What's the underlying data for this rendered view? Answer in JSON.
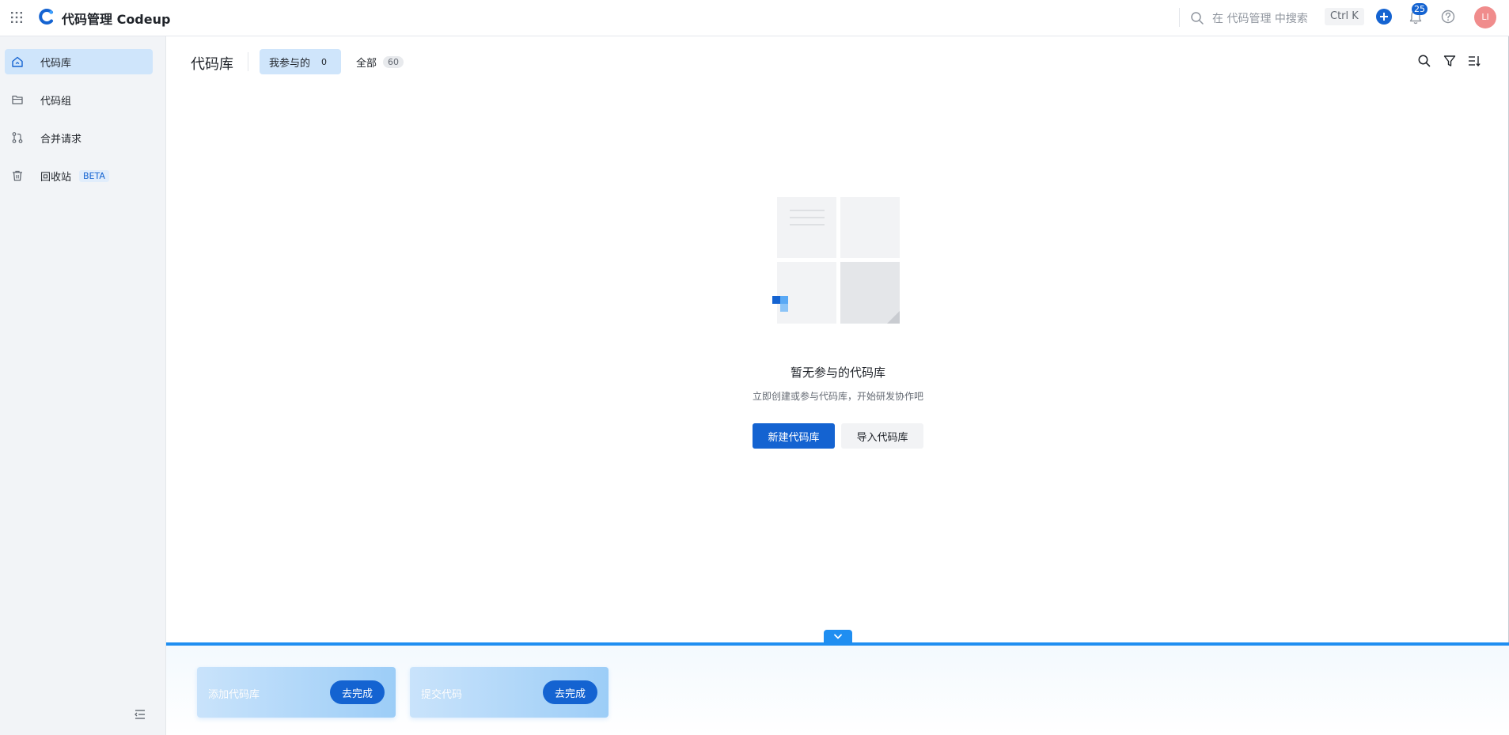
{
  "app": {
    "brand": "代码管理 Codeup",
    "search_placeholder": "在 代码管理 中搜索",
    "search_shortcut": "Ctrl K",
    "notification_count": "25",
    "avatar_initials": "LI",
    "accent_color": "#1463d1"
  },
  "sidebar": {
    "items": [
      {
        "label": "代码库",
        "icon": "home-icon"
      },
      {
        "label": "代码组",
        "icon": "folder-icon"
      },
      {
        "label": "合并请求",
        "icon": "merge-request-icon"
      },
      {
        "label": "回收站",
        "icon": "trash-icon",
        "badge": "BETA"
      }
    ]
  },
  "main": {
    "title": "代码库",
    "tabs": [
      {
        "label": "我参与的",
        "count": "0"
      },
      {
        "label": "全部",
        "count": "60"
      }
    ],
    "empty": {
      "title": "暂无参与的代码库",
      "description": "立即创建或参与代码库，开始研发协作吧",
      "primary_button": "新建代码库",
      "secondary_button": "导入代码库"
    }
  },
  "tasks": [
    {
      "label": "添加代码库",
      "action": "去完成"
    },
    {
      "label": "提交代码",
      "action": "去完成"
    }
  ]
}
